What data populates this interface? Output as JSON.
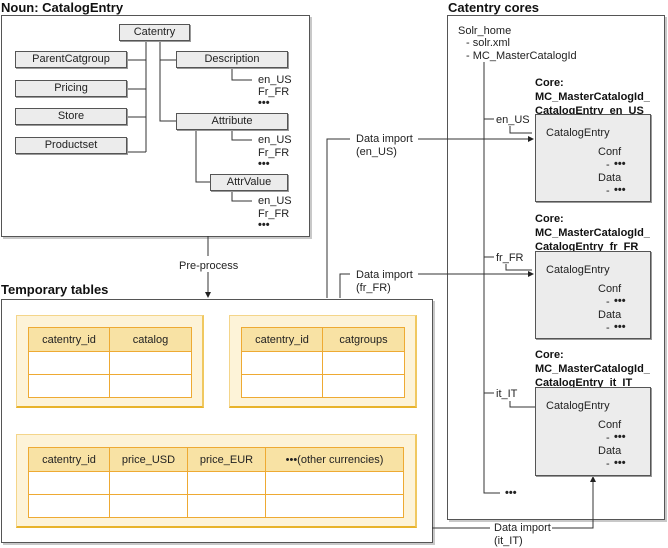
{
  "noun_section": {
    "title": "Noun: CatalogEntry",
    "root": "Catentry",
    "left_nodes": [
      "ParentCatgroup",
      "Pricing",
      "Store",
      "Productset"
    ],
    "right_nodes": [
      {
        "label": "Description",
        "locales": [
          "en_US",
          "Fr_FR",
          "•••"
        ]
      },
      {
        "label": "Attribute",
        "locales": [
          "en_US",
          "Fr_FR",
          "•••"
        ]
      },
      {
        "label": "AttrValue",
        "locales": [
          "en_US",
          "Fr_FR",
          "•••"
        ]
      }
    ]
  },
  "preprocess_label": "Pre-process",
  "temp_section": {
    "title": "Temporary tables",
    "tables": [
      {
        "headers": [
          "catentry_id",
          "catalog"
        ],
        "rows": [
          [
            "",
            ""
          ],
          [
            "",
            ""
          ]
        ]
      },
      {
        "headers": [
          "catentry_id",
          "catgroups"
        ],
        "rows": [
          [
            "",
            ""
          ],
          [
            "",
            ""
          ]
        ]
      },
      {
        "headers": [
          "catentry_id",
          "price_USD",
          "price_EUR",
          "•••(other currencies)"
        ],
        "rows": [
          [
            "",
            "",
            "",
            ""
          ],
          [
            "",
            "",
            "",
            ""
          ]
        ]
      }
    ]
  },
  "imports": [
    {
      "line1": "Data import",
      "line2": "(en_US)"
    },
    {
      "line1": "Data import",
      "line2": "(fr_FR)"
    },
    {
      "line1": "Data import",
      "line2": "(it_IT)"
    }
  ],
  "cores_section": {
    "title": "Catentry cores",
    "tree": [
      "Solr_home",
      "- solr.xml",
      "- MC_MasterCatalogId"
    ],
    "cores": [
      {
        "locale": "en_US",
        "title": [
          "Core:",
          "MC_MasterCatalogId_",
          "CatalogEntry_en_US"
        ],
        "entry": "CatalogEntry",
        "conf": "Conf",
        "data": "Data",
        "more": "•••",
        "bullet": "-"
      },
      {
        "locale": "fr_FR",
        "title": [
          "Core:",
          "MC_MasterCatalogId_",
          "CatalogEntry_fr_FR"
        ],
        "entry": "CatalogEntry",
        "conf": "Conf",
        "data": "Data",
        "more": "•••",
        "bullet": "-"
      },
      {
        "locale": "it_IT",
        "title": [
          "Core:",
          "MC_MasterCatalogId_",
          "CatalogEntry_it_IT"
        ],
        "entry": "CatalogEntry",
        "conf": "Conf",
        "data": "Data",
        "more": "•••",
        "bullet": "-"
      }
    ],
    "more": "•••"
  },
  "colors": {
    "table_bg": "#fdf3d8",
    "table_header": "#f8e2a4",
    "table_border": "#eeaa33",
    "node_bg": "#ececec"
  }
}
